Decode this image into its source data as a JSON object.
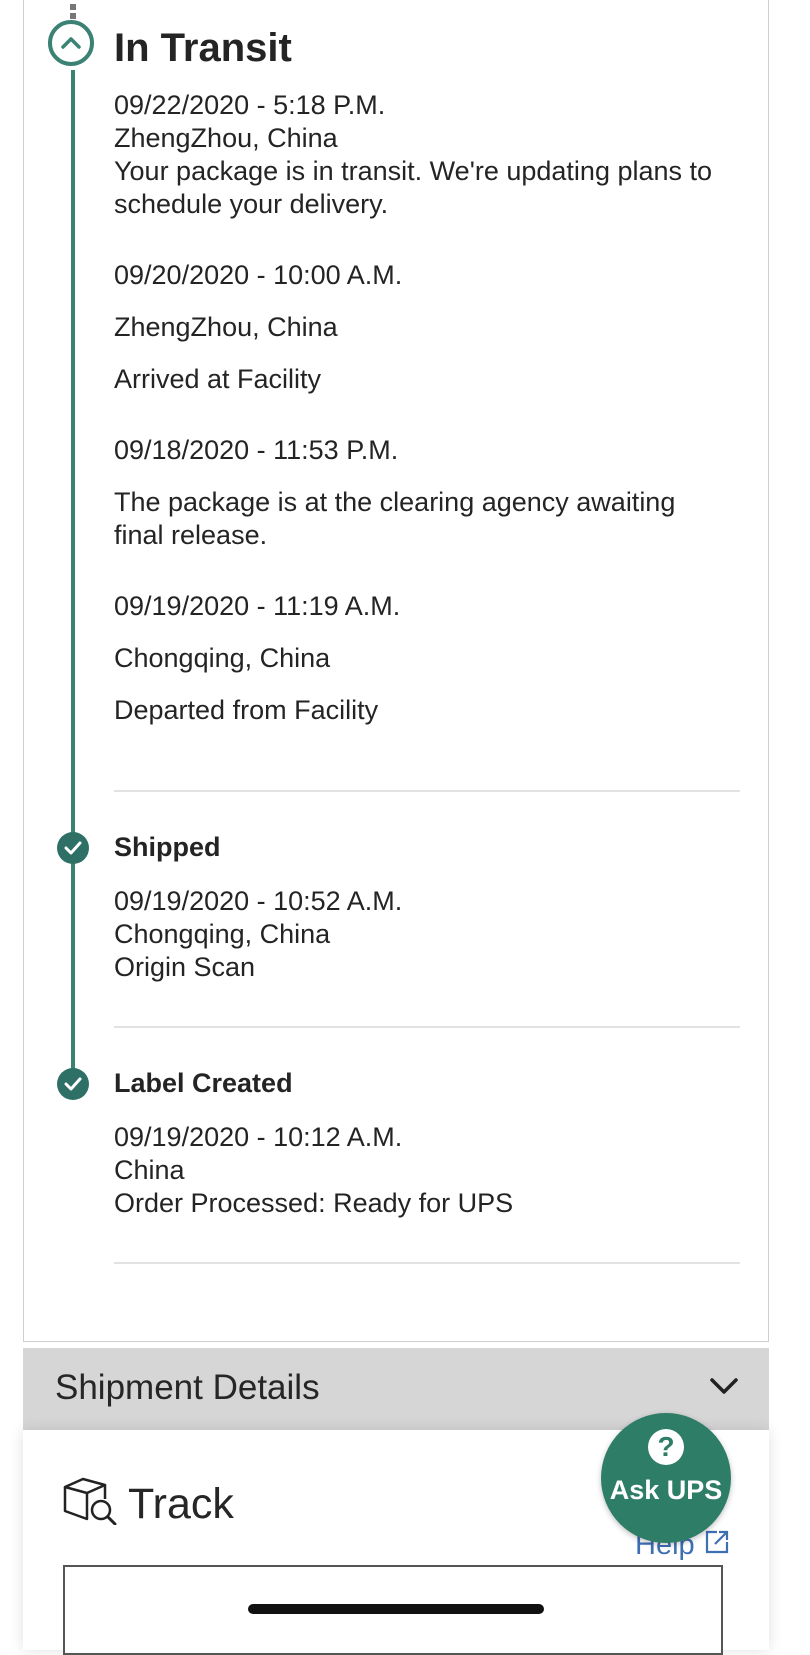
{
  "timeline": {
    "in_transit": {
      "title": "In Transit",
      "events": [
        {
          "datetime": "09/22/2020 - 5:18 P.M.",
          "location": "ZhengZhou, China",
          "desc_line1": "Your package is in transit. We're updating plans to",
          "desc_line2": "schedule your delivery."
        },
        {
          "datetime": "09/20/2020 - 10:00 A.M.",
          "location": "ZhengZhou, China",
          "desc": "Arrived at Facility"
        },
        {
          "datetime": "09/18/2020 - 11:53 P.M.",
          "desc_line1": "The package is at the clearing agency awaiting",
          "desc_line2": "final release."
        },
        {
          "datetime": "09/19/2020 - 11:19 A.M.",
          "location": "Chongqing, China",
          "desc": "Departed from Facility"
        }
      ]
    },
    "shipped": {
      "title": "Shipped",
      "datetime": "09/19/2020 - 10:52 A.M.",
      "location": "Chongqing, China",
      "desc": "Origin Scan"
    },
    "label_created": {
      "title": "Label Created",
      "datetime": "09/19/2020 - 10:12 A.M.",
      "location": "China",
      "desc": "Order Processed: Ready for UPS"
    }
  },
  "shipment_details": {
    "label": "Shipment Details"
  },
  "track": {
    "label": "Track",
    "help_link": "Help"
  },
  "ask_ups": {
    "label": "Ask UPS",
    "icon_glyph": "?"
  },
  "colors": {
    "accent": "#3b8174",
    "ask_button": "#2e7d66",
    "link": "#3e6fb5",
    "details_bar": "#d6d6d6"
  }
}
